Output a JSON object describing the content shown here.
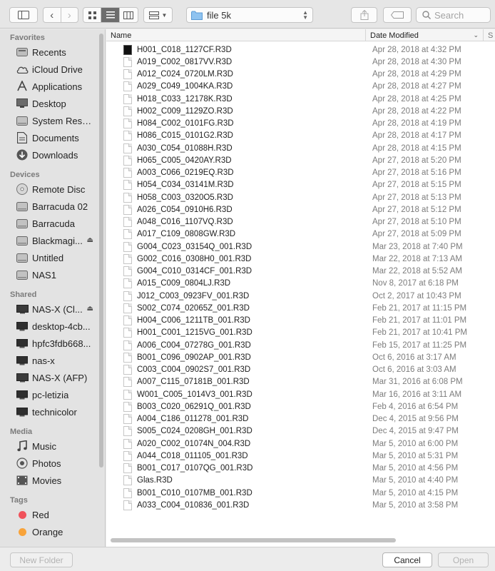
{
  "toolbar": {
    "path_label": "file 5k",
    "search_placeholder": "Search"
  },
  "sidebar": {
    "favorites_header": "Favorites",
    "favorites": [
      {
        "label": "Recents",
        "icon": "recents-icon"
      },
      {
        "label": "iCloud Drive",
        "icon": "cloud-icon"
      },
      {
        "label": "Applications",
        "icon": "applications-icon"
      },
      {
        "label": "Desktop",
        "icon": "desktop-icon"
      },
      {
        "label": "System Reser...",
        "icon": "disk-icon"
      },
      {
        "label": "Documents",
        "icon": "document-icon"
      },
      {
        "label": "Downloads",
        "icon": "download-icon"
      }
    ],
    "devices_header": "Devices",
    "devices": [
      {
        "label": "Remote Disc",
        "icon": "remote-disc-icon"
      },
      {
        "label": "Barracuda 02",
        "icon": "disk-icon"
      },
      {
        "label": "Barracuda",
        "icon": "disk-icon"
      },
      {
        "label": "Blackmagi...",
        "icon": "disk-icon",
        "eject": true
      },
      {
        "label": "Untitled",
        "icon": "disk-icon"
      },
      {
        "label": "NAS1",
        "icon": "disk-icon"
      }
    ],
    "shared_header": "Shared",
    "shared": [
      {
        "label": "NAS-X (Cl...",
        "icon": "server-icon",
        "eject": true
      },
      {
        "label": "desktop-4cb...",
        "icon": "computer-icon"
      },
      {
        "label": "hpfc3fdb668...",
        "icon": "computer-icon"
      },
      {
        "label": "nas-x",
        "icon": "computer-icon"
      },
      {
        "label": "NAS-X (AFP)",
        "icon": "server-icon"
      },
      {
        "label": "pc-letizia",
        "icon": "computer-icon"
      },
      {
        "label": "technicolor",
        "icon": "computer-icon"
      }
    ],
    "media_header": "Media",
    "media": [
      {
        "label": "Music",
        "icon": "music-icon"
      },
      {
        "label": "Photos",
        "icon": "photos-icon"
      },
      {
        "label": "Movies",
        "icon": "movies-icon"
      }
    ],
    "tags_header": "Tags",
    "tags": [
      {
        "label": "Red",
        "color": "#f0525b"
      },
      {
        "label": "Orange",
        "color": "#f8a33a"
      }
    ]
  },
  "list": {
    "col_name": "Name",
    "col_date": "Date Modified",
    "col_more": "S",
    "files": [
      {
        "name": "H001_C018_1127CF.R3D",
        "date": "Apr 28, 2018 at 4:32 PM",
        "thumb": true
      },
      {
        "name": "A019_C002_0817VV.R3D",
        "date": "Apr 28, 2018 at 4:30 PM"
      },
      {
        "name": "A012_C024_0720LM.R3D",
        "date": "Apr 28, 2018 at 4:29 PM"
      },
      {
        "name": "A029_C049_1004KA.R3D",
        "date": "Apr 28, 2018 at 4:27 PM"
      },
      {
        "name": "H018_C033_12178K.R3D",
        "date": "Apr 28, 2018 at 4:25 PM"
      },
      {
        "name": "H002_C009_1129ZO.R3D",
        "date": "Apr 28, 2018 at 4:22 PM"
      },
      {
        "name": "H084_C002_0101FG.R3D",
        "date": "Apr 28, 2018 at 4:19 PM"
      },
      {
        "name": "H086_C015_0101G2.R3D",
        "date": "Apr 28, 2018 at 4:17 PM"
      },
      {
        "name": "A030_C054_01088H.R3D",
        "date": "Apr 28, 2018 at 4:15 PM"
      },
      {
        "name": "H065_C005_0420AY.R3D",
        "date": "Apr 27, 2018 at 5:20 PM"
      },
      {
        "name": "A003_C066_0219EQ.R3D",
        "date": "Apr 27, 2018 at 5:16 PM"
      },
      {
        "name": "H054_C034_03141M.R3D",
        "date": "Apr 27, 2018 at 5:15 PM"
      },
      {
        "name": "H058_C003_0320O5.R3D",
        "date": "Apr 27, 2018 at 5:13 PM"
      },
      {
        "name": "A026_C054_0910H6.R3D",
        "date": "Apr 27, 2018 at 5:12 PM"
      },
      {
        "name": "A048_C016_1107VQ.R3D",
        "date": "Apr 27, 2018 at 5:10 PM"
      },
      {
        "name": "A017_C109_0808GW.R3D",
        "date": "Apr 27, 2018 at 5:09 PM"
      },
      {
        "name": "G004_C023_03154Q_001.R3D",
        "date": "Mar 23, 2018 at 7:40 PM"
      },
      {
        "name": "G002_C016_0308H0_001.R3D",
        "date": "Mar 22, 2018 at 7:13 AM"
      },
      {
        "name": "G004_C010_0314CF_001.R3D",
        "date": "Mar 22, 2018 at 5:52 AM"
      },
      {
        "name": "A015_C009_0804LJ.R3D",
        "date": "Nov 8, 2017 at 6:18 PM"
      },
      {
        "name": "J012_C003_0923FV_001.R3D",
        "date": "Oct 2, 2017 at 10:43 PM"
      },
      {
        "name": "S002_C074_02065Z_001.R3D",
        "date": "Feb 21, 2017 at 11:15 PM"
      },
      {
        "name": "H004_C006_1211TB_001.R3D",
        "date": "Feb 21, 2017 at 11:01 PM"
      },
      {
        "name": "H001_C001_1215VG_001.R3D",
        "date": "Feb 21, 2017 at 10:41 PM"
      },
      {
        "name": "A006_C004_07278G_001.R3D",
        "date": "Feb 15, 2017 at 11:25 PM"
      },
      {
        "name": "B001_C096_0902AP_001.R3D",
        "date": "Oct 6, 2016 at 3:17 AM"
      },
      {
        "name": "C003_C004_0902S7_001.R3D",
        "date": "Oct 6, 2016 at 3:03 AM"
      },
      {
        "name": "A007_C115_07181B_001.R3D",
        "date": "Mar 31, 2016 at 6:08 PM"
      },
      {
        "name": "W001_C005_1014V3_001.R3D",
        "date": "Mar 16, 2016 at 3:11 AM"
      },
      {
        "name": "B003_C020_06291Q_001.R3D",
        "date": "Feb 4, 2016 at 6:54 PM"
      },
      {
        "name": "A004_C186_011278_001.R3D",
        "date": "Dec 4, 2015 at 9:56 PM"
      },
      {
        "name": "S005_C024_0208GH_001.R3D",
        "date": "Dec 4, 2015 at 9:47 PM"
      },
      {
        "name": "A020_C002_01074N_004.R3D",
        "date": "Mar 5, 2010 at 6:00 PM"
      },
      {
        "name": "A044_C018_011105_001.R3D",
        "date": "Mar 5, 2010 at 5:31 PM"
      },
      {
        "name": "B001_C017_0107QG_001.R3D",
        "date": "Mar 5, 2010 at 4:56 PM"
      },
      {
        "name": "Glas.R3D",
        "date": "Mar 5, 2010 at 4:40 PM"
      },
      {
        "name": "B001_C010_0107MB_001.R3D",
        "date": "Mar 5, 2010 at 4:15 PM"
      },
      {
        "name": "A033_C004_010836_001.R3D",
        "date": "Mar 5, 2010 at 3:58 PM"
      }
    ]
  },
  "footer": {
    "new_folder": "New Folder",
    "cancel": "Cancel",
    "open": "Open"
  }
}
